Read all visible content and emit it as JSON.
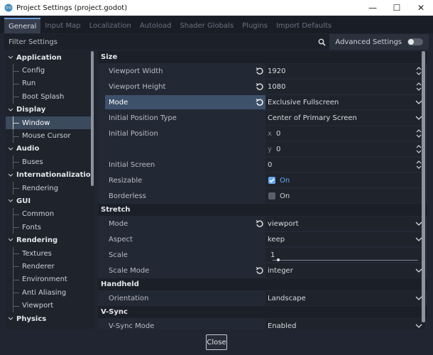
{
  "window": {
    "title": "Project Settings (project.godot)",
    "minimize_glyph": "—",
    "maximize_glyph": "☐",
    "close_glyph": "✕"
  },
  "tabs": [
    "General",
    "Input Map",
    "Localization",
    "Autoload",
    "Shader Globals",
    "Plugins",
    "Import Defaults"
  ],
  "filter": {
    "placeholder": "Filter Settings",
    "value": ""
  },
  "advanced_settings": {
    "label": "Advanced Settings",
    "enabled": false
  },
  "sidebar": {
    "categories": [
      {
        "label": "Application",
        "items": [
          "Config",
          "Run",
          "Boot Splash"
        ]
      },
      {
        "label": "Display",
        "items": [
          "Window",
          "Mouse Cursor"
        ]
      },
      {
        "label": "Audio",
        "items": [
          "Buses"
        ]
      },
      {
        "label": "Internationalization",
        "items": [
          "Rendering"
        ]
      },
      {
        "label": "GUI",
        "items": [
          "Common",
          "Fonts"
        ]
      },
      {
        "label": "Rendering",
        "items": [
          "Textures",
          "Renderer",
          "Environment",
          "Anti Aliasing",
          "Viewport"
        ]
      },
      {
        "label": "Physics",
        "items": []
      }
    ],
    "selected": "Window"
  },
  "properties": {
    "size_header": "Size",
    "viewport_width": {
      "label": "Viewport Width",
      "value": "1920"
    },
    "viewport_height": {
      "label": "Viewport Height",
      "value": "1080"
    },
    "mode": {
      "label": "Mode",
      "value": "Exclusive Fullscreen"
    },
    "initial_position_type": {
      "label": "Initial Position Type",
      "value": "Center of Primary Screen"
    },
    "initial_position": {
      "label": "Initial Position",
      "x_axis": "x",
      "x_value": "0",
      "y_axis": "y",
      "y_value": "0"
    },
    "initial_screen": {
      "label": "Initial Screen",
      "value": "0"
    },
    "resizable": {
      "label": "Resizable",
      "value": "On",
      "checked": true
    },
    "borderless": {
      "label": "Borderless",
      "value": "On",
      "checked": false
    },
    "stretch_header": "Stretch",
    "stretch_mode": {
      "label": "Mode",
      "value": "viewport"
    },
    "aspect": {
      "label": "Aspect",
      "value": "keep"
    },
    "scale": {
      "label": "Scale",
      "value": "1"
    },
    "scale_mode": {
      "label": "Scale Mode",
      "value": "integer"
    },
    "handheld_header": "Handheld",
    "orientation": {
      "label": "Orientation",
      "value": "Landscape"
    },
    "vsync_header": "V-Sync",
    "vsync_mode": {
      "label": "V-Sync Mode",
      "value": "Enabled"
    }
  },
  "footer": {
    "close_label": "Close"
  },
  "colors": {
    "background": "#202531",
    "panel": "#232934",
    "accent": "#6aa9f2",
    "selection": "#3e516b"
  }
}
